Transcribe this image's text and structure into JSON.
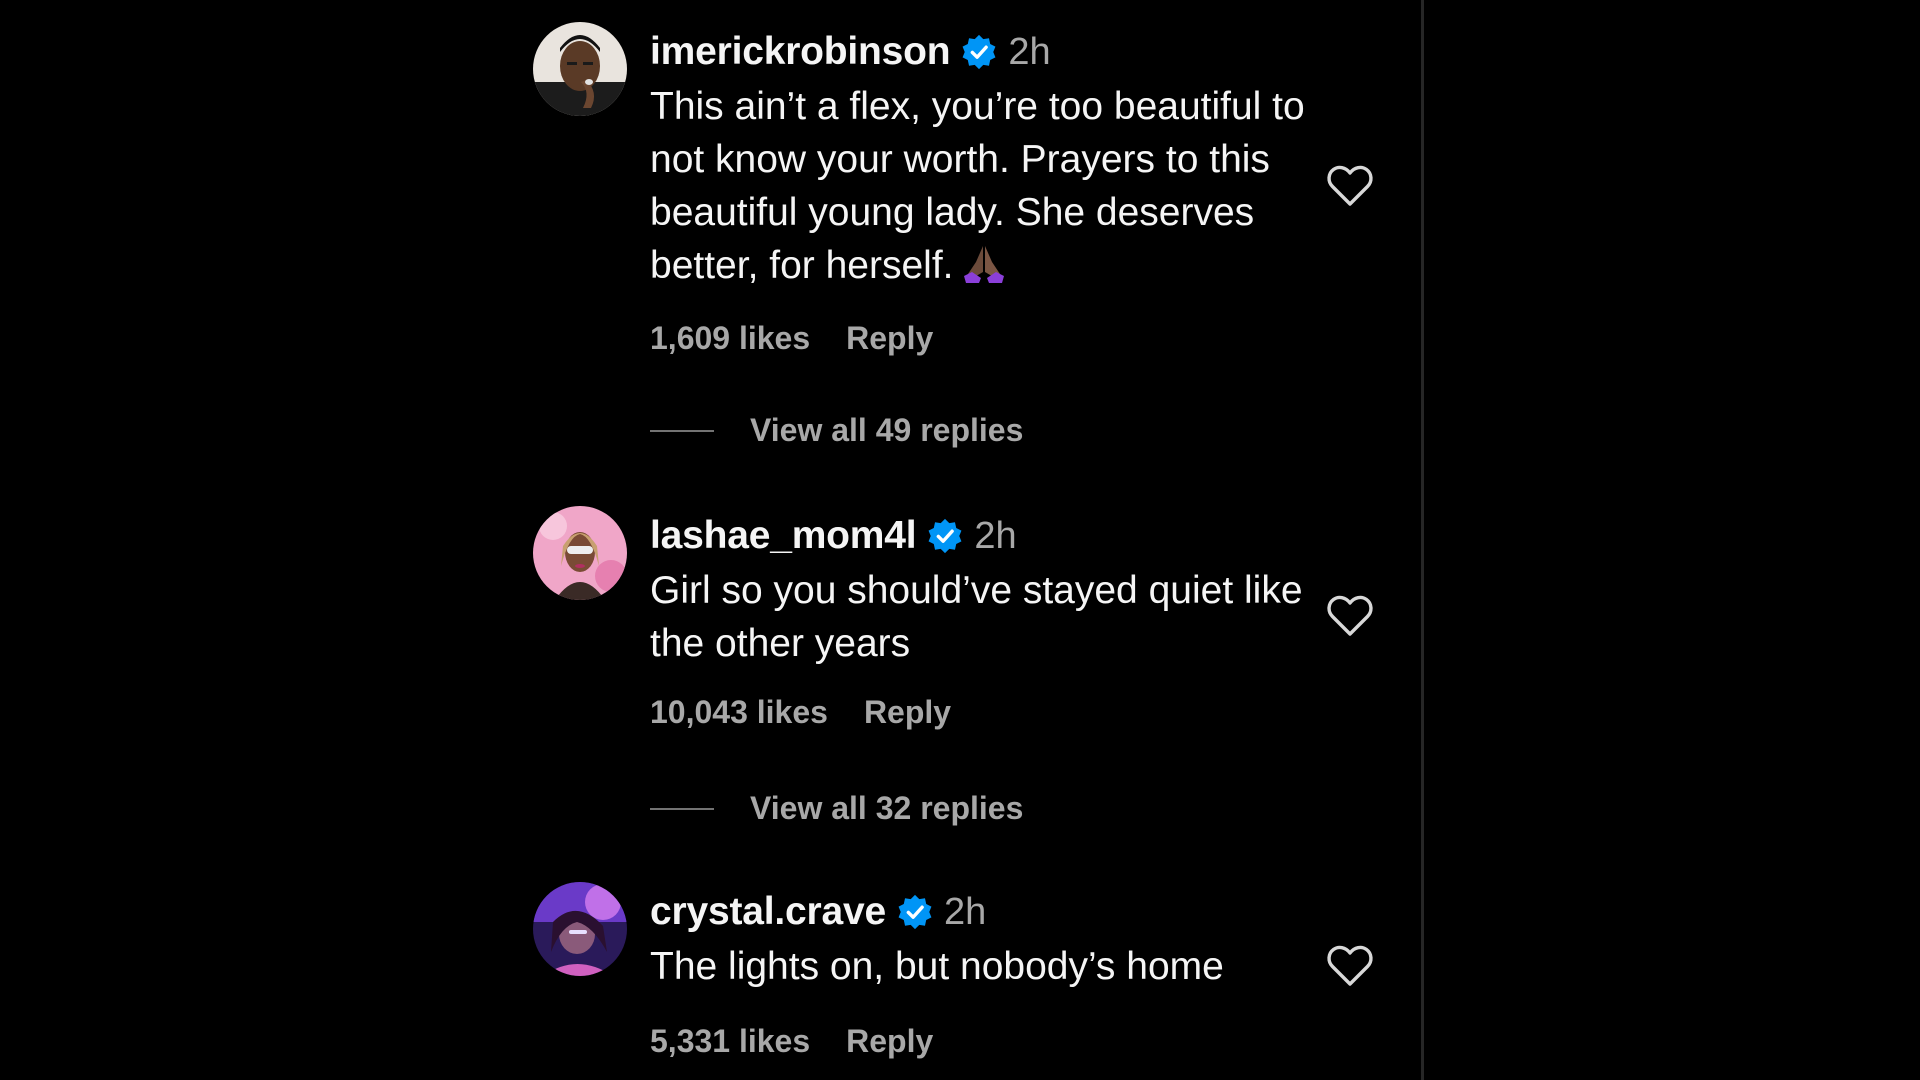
{
  "comments": [
    {
      "username": "imerickrobinson",
      "time": "2h",
      "text": "This ain’t a flex, you’re too beautiful to not know your worth. Prayers to this beautiful young lady. She deserves better, for herself.",
      "emoji_icon": "praying-hands-icon",
      "likes": "1,609 likes",
      "reply": "Reply",
      "view_replies": "View all 49 replies"
    },
    {
      "username": "lashae_mom4l",
      "time": "2h",
      "text": "Girl so you should’ve stayed quiet like the other years",
      "likes": "10,043 likes",
      "reply": "Reply",
      "view_replies": "View all 32 replies"
    },
    {
      "username": "crystal.crave",
      "time": "2h",
      "text": "The lights on, but nobody’s home",
      "likes": "5,331 likes",
      "reply": "Reply"
    }
  ],
  "colors": {
    "background": "#000000",
    "primary_text": "#f5f5f5",
    "secondary_text": "#a8a8a8",
    "verified_badge": "#0095f6",
    "divider": "#262626"
  }
}
